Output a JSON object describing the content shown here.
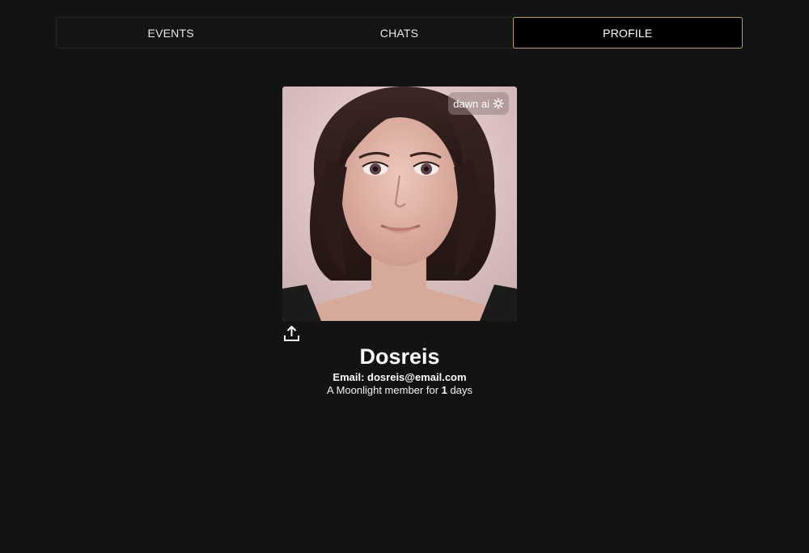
{
  "tabs": [
    {
      "label": "EVENTS",
      "active": false
    },
    {
      "label": "CHATS",
      "active": false
    },
    {
      "label": "PROFILE",
      "active": true
    }
  ],
  "profile": {
    "watermark": "dawn ai",
    "name": "Dosreis",
    "email_label": "Email: dosreis@email.com",
    "member_prefix": "A Moonlight member for",
    "member_days": "1",
    "member_suffix": "days"
  },
  "icons": {
    "upload": "upload-icon",
    "watermark": "sparkle-icon"
  },
  "colors": {
    "background": "#131313",
    "active_tab_border": "#b89a63"
  }
}
